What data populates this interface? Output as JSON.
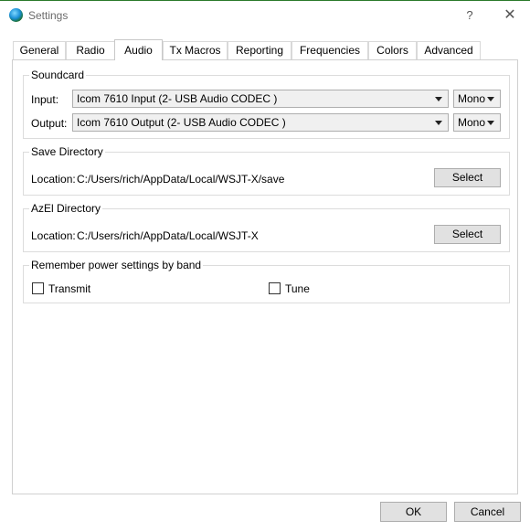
{
  "window": {
    "title": "Settings",
    "help_label": "?",
    "close_label": "✕"
  },
  "tabs": [
    {
      "label": "General"
    },
    {
      "label": "Radio"
    },
    {
      "label": "Audio",
      "active": true
    },
    {
      "label": "Tx Macros"
    },
    {
      "label": "Reporting"
    },
    {
      "label": "Frequencies"
    },
    {
      "label": "Colors"
    },
    {
      "label": "Advanced"
    }
  ],
  "soundcard": {
    "title": "Soundcard",
    "input_label": "Input:",
    "input_value": "Icom 7610 Input (2- USB Audio CODEC )",
    "input_channel": "Mono",
    "output_label": "Output:",
    "output_value": "Icom 7610 Output (2- USB Audio CODEC )",
    "output_channel": "Mono"
  },
  "save_directory": {
    "title": "Save Directory",
    "location_label": "Location:",
    "location_value": "C:/Users/rich/AppData/Local/WSJT-X/save",
    "select_label": "Select"
  },
  "azel_directory": {
    "title": "AzEl Directory",
    "location_label": "Location:",
    "location_value": "C:/Users/rich/AppData/Local/WSJT-X",
    "select_label": "Select"
  },
  "power_settings": {
    "title": "Remember power settings by band",
    "transmit_label": "Transmit",
    "transmit_checked": false,
    "tune_label": "Tune",
    "tune_checked": false
  },
  "footer": {
    "ok_label": "OK",
    "cancel_label": "Cancel"
  }
}
